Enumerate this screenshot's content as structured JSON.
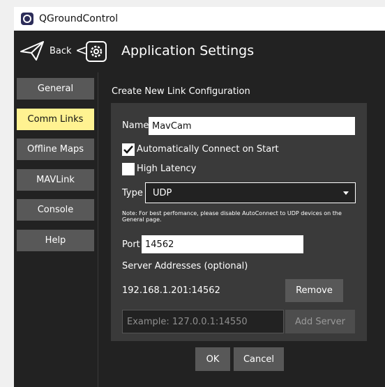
{
  "window": {
    "title": "QGroundControl"
  },
  "header": {
    "back_label": "Back",
    "separator": "<",
    "title": "Application Settings"
  },
  "sidebar": {
    "items": [
      {
        "label": "General",
        "active": false
      },
      {
        "label": "Comm Links",
        "active": true
      },
      {
        "label": "Offline Maps",
        "active": false
      },
      {
        "label": "MAVLink",
        "active": false
      },
      {
        "label": "Console",
        "active": false
      },
      {
        "label": "Help",
        "active": false
      }
    ]
  },
  "form": {
    "section_title": "Create New Link Configuration",
    "name_label": "Name",
    "name_value": "MavCam",
    "auto_connect": {
      "label": "Automatically Connect on Start",
      "checked": true
    },
    "high_latency": {
      "label": "High Latency",
      "checked": false
    },
    "type_label": "Type",
    "type_value": "UDP",
    "note": "Note: For best perfomance, please disable AutoConnect to UDP devices on the General page.",
    "port_label": "Port",
    "port_value": "14562",
    "servers_label": "Server Addresses (optional)",
    "server_address": "192.168.1.201:14562",
    "remove_label": "Remove",
    "server_placeholder": "Example: 127.0.0.1:14550",
    "add_server_label": "Add Server"
  },
  "footer": {
    "ok_label": "OK",
    "cancel_label": "Cancel"
  },
  "colors": {
    "accent": "#fff291",
    "background": "#222222",
    "panel": "#3a3a3a",
    "button": "#585858"
  }
}
